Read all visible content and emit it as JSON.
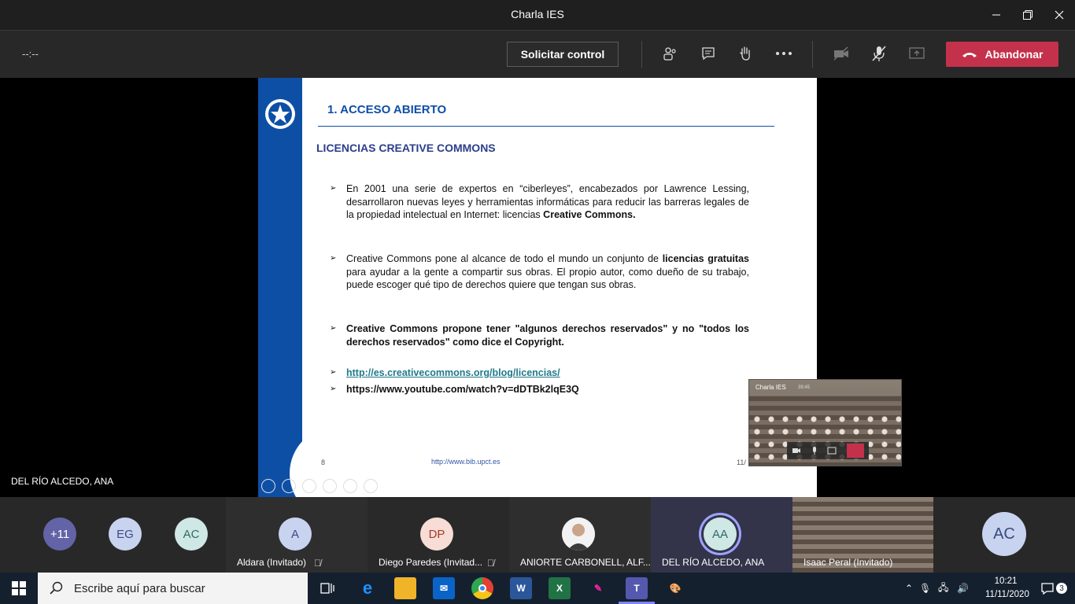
{
  "window": {
    "title": "Charla IES"
  },
  "toolbar": {
    "timer": "--:--",
    "request_control_label": "Solicitar control",
    "leave_label": "Abandonar",
    "accent_leave": "#c4314b"
  },
  "slide": {
    "heading": "1. ACCESO ABIERTO",
    "subheading": "LICENCIAS CREATIVE COMMONS",
    "bullet1_a": "En 2001 una serie de expertos en “ciberleyes”, encabezados por Lawrence Lessing, desarrollaron nuevas leyes y herramientas informáticas para reducir las barreras legales de la propiedad intelectual en Internet: licencias ",
    "bullet1_b": "Creative Commons.",
    "bullet2_a": "Creative Commons pone al alcance de todo el mundo un conjunto de ",
    "bullet2_b": "licencias gratuitas",
    "bullet2_c": " para ayudar a la gente a compartir sus obras. El propio autor, como dueño de su trabajo, puede escoger qué tipo de derechos quiere que tengan sus obras.",
    "bullet3": "Creative Commons propone tener \"algunos derechos reservados\" y no \"todos los derechos reservados\" como dice el Copyright.",
    "link1": "http://es.creativecommons.org/blog/licencias/",
    "link2": "https://www.youtube.com/watch?v=dDTBk2lqE3Q",
    "footer_num": "8",
    "footer_url": "http://www.bib.upct.es",
    "footer_page": "11/"
  },
  "pip": {
    "title": "Charla IES",
    "time": "39:45"
  },
  "presenter": {
    "name": "DEL RÍO ALCEDO, ANA"
  },
  "roster": {
    "overflow": "+11",
    "avatars": [
      {
        "initials": "EG",
        "color": "#c8d3f0"
      },
      {
        "initials": "AC",
        "color": "#cfe8e6"
      }
    ],
    "tiles": [
      {
        "initials": "A",
        "name": "Aldara (Invitado)"
      },
      {
        "initials": "DP",
        "name": "Diego Paredes (Invitad..."
      },
      {
        "initials": "",
        "name": "ANIORTE CARBONELL, ALF..."
      },
      {
        "initials": "AA",
        "name": "DEL RÍO ALCEDO, ANA"
      },
      {
        "initials": "",
        "name": "Isaac Peral (Invitado)"
      },
      {
        "initials": "AC",
        "name": ""
      }
    ]
  },
  "taskbar": {
    "search_placeholder": "Escribe aquí para buscar",
    "time": "10:21",
    "date": "11/11/2020",
    "notifications": "3"
  }
}
